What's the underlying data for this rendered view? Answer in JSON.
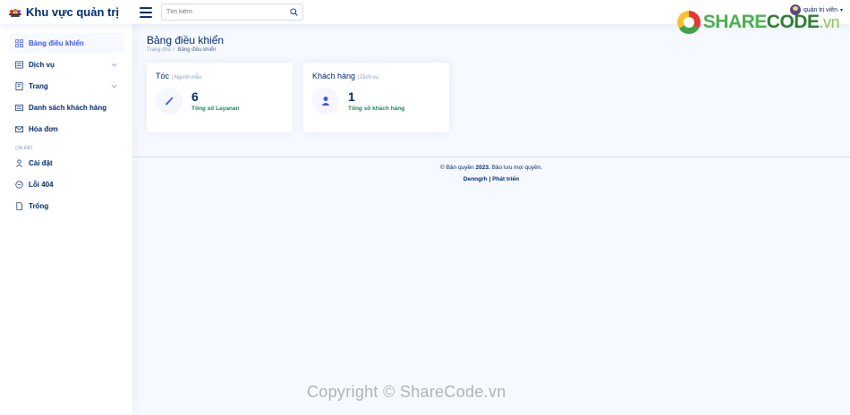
{
  "header": {
    "logo_text": "Khu vực quản trị",
    "search": {
      "placeholder": "Tìm kiếm"
    },
    "user_name": "quản trị viên"
  },
  "brand_watermark": {
    "share": "SHARE",
    "code": "CODE",
    "vn": ".vn"
  },
  "sidebar": {
    "items": [
      {
        "label": "Bảng điều khiển",
        "icon": "grid-icon",
        "active": true
      },
      {
        "label": "Dịch vụ",
        "icon": "menu-icon",
        "has_chevron": true
      },
      {
        "label": "Trang",
        "icon": "journal-icon",
        "has_chevron": true
      },
      {
        "label": "Danh sách khách hàng",
        "icon": "list-icon"
      },
      {
        "label": "Hóa đơn",
        "icon": "envelope-icon"
      }
    ],
    "heading": "CÀI ĐẶT",
    "settings_items": [
      {
        "label": "Cài đặt",
        "icon": "person-icon"
      },
      {
        "label": "Lỗi 404",
        "icon": "dash-circle-icon"
      },
      {
        "label": "Trống",
        "icon": "file-icon"
      }
    ]
  },
  "main": {
    "page_title": "Bảng điều khiển",
    "breadcrumb": {
      "home": "Trang chủ",
      "sep": "/",
      "current": "Bảng điều khiển"
    },
    "cards": [
      {
        "title": "Tóc",
        "subtitle": "| Người mẫu",
        "count": "6",
        "label": "Tổng số Layanan",
        "icon": "pen-icon"
      },
      {
        "title": "Khách hàng",
        "subtitle": "| Dịch vụ",
        "count": "1",
        "label": "Tổng số khách hàng",
        "icon": "person-fill-icon"
      }
    ]
  },
  "footer": {
    "copyright_prefix": "© Bản quyền",
    "year": "2023.",
    "rights": "Bảo lưu mọi quyền.",
    "author": "Denngrh",
    "sep": "|",
    "developed": "Phát triển"
  },
  "watermark_text": "Copyright © ShareCode.vn",
  "colors": {
    "primary": "#012970",
    "accent": "#4154f1",
    "success": "#198754",
    "background": "#f6f9ff"
  }
}
